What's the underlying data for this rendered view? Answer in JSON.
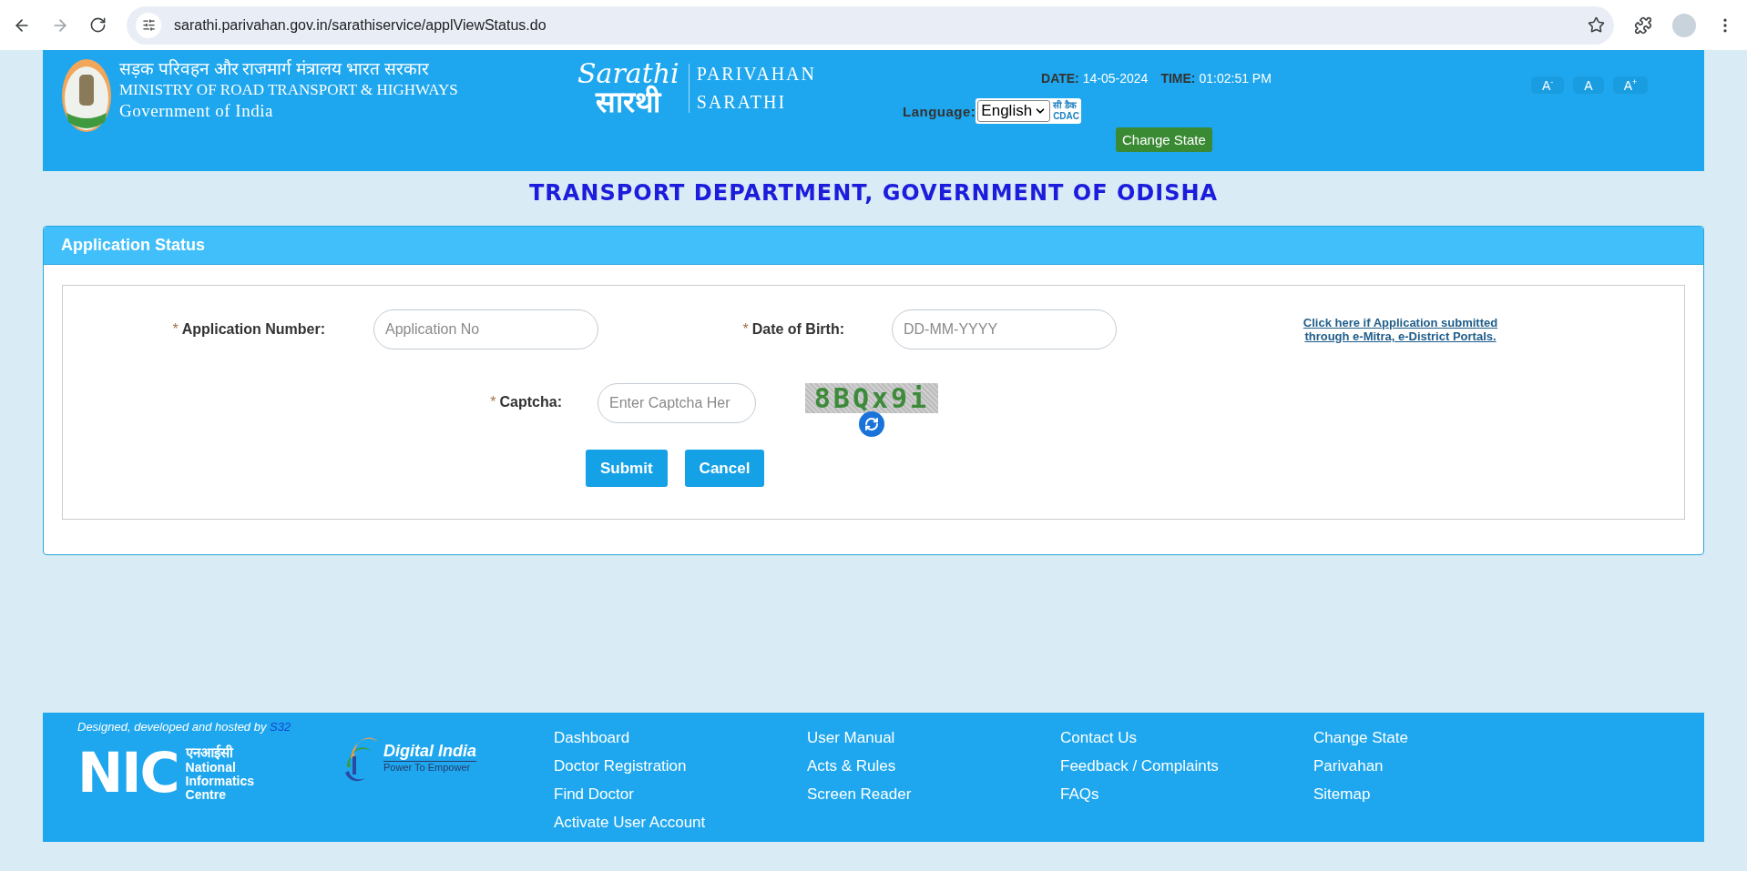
{
  "browser": {
    "url": "sarathi.parivahan.gov.in/sarathiservice/applViewStatus.do"
  },
  "header": {
    "ministry_hindi": "सड़क परिवहन और राजमार्ग मंत्रालय भारत सरकार",
    "ministry": "MINISTRY OF ROAD TRANSPORT & HIGHWAYS",
    "government": "Government of India",
    "logo_latin": "Sarathi",
    "logo_hindi": "सारथी",
    "logo_lines": [
      "PARIVAHAN",
      "SARATHI"
    ],
    "date_label": "DATE:",
    "date": "14-05-2024",
    "time_label": "TIME:",
    "time": "01:02:51 PM",
    "language_label": "Language:",
    "language": "English",
    "cdac_hindi": "सी डैक",
    "cdac": "CDAC",
    "change_state": "Change State",
    "font_buttons": [
      "A$^{-}$",
      "A",
      "A$^{+}$"
    ]
  },
  "department_title": "TRANSPORT DEPARTMENT, GOVERNMENT OF ODISHA",
  "panel": {
    "title": "Application Status",
    "fields": [
      {
        "mark": "*",
        "label": "Application Number:",
        "placeholder": "Application No"
      },
      {
        "mark": "*",
        "label": "Date of Birth:",
        "placeholder": "DD-MM-YYYY"
      },
      {
        "mark": "*",
        "label": "Captcha:",
        "placeholder": "Enter Captcha Her"
      }
    ],
    "portal_link": "Click here if Application submitted through e-Mitra, e-District Portals.",
    "captcha": "8BQx9i",
    "buttons": [
      "Submit",
      "Cancel"
    ]
  },
  "footer": {
    "credit": "Designed, developed and hosted by",
    "credit_link": "S32",
    "nic": "NIC",
    "nic_hindi": "एनआईसी",
    "nic_name": "National Informatics Centre",
    "digital_india": "Digital India",
    "digital_india_tagline": "Power To Empower",
    "link_columns": [
      [
        "Dashboard",
        "Doctor Registration",
        "Find Doctor",
        "Activate User Account"
      ],
      [
        "User Manual",
        "Acts & Rules",
        "Screen Reader"
      ],
      [
        "Contact Us",
        "Feedback / Complaints",
        "FAQs"
      ],
      [
        "Change State",
        "Parivahan",
        "Sitemap"
      ]
    ]
  }
}
